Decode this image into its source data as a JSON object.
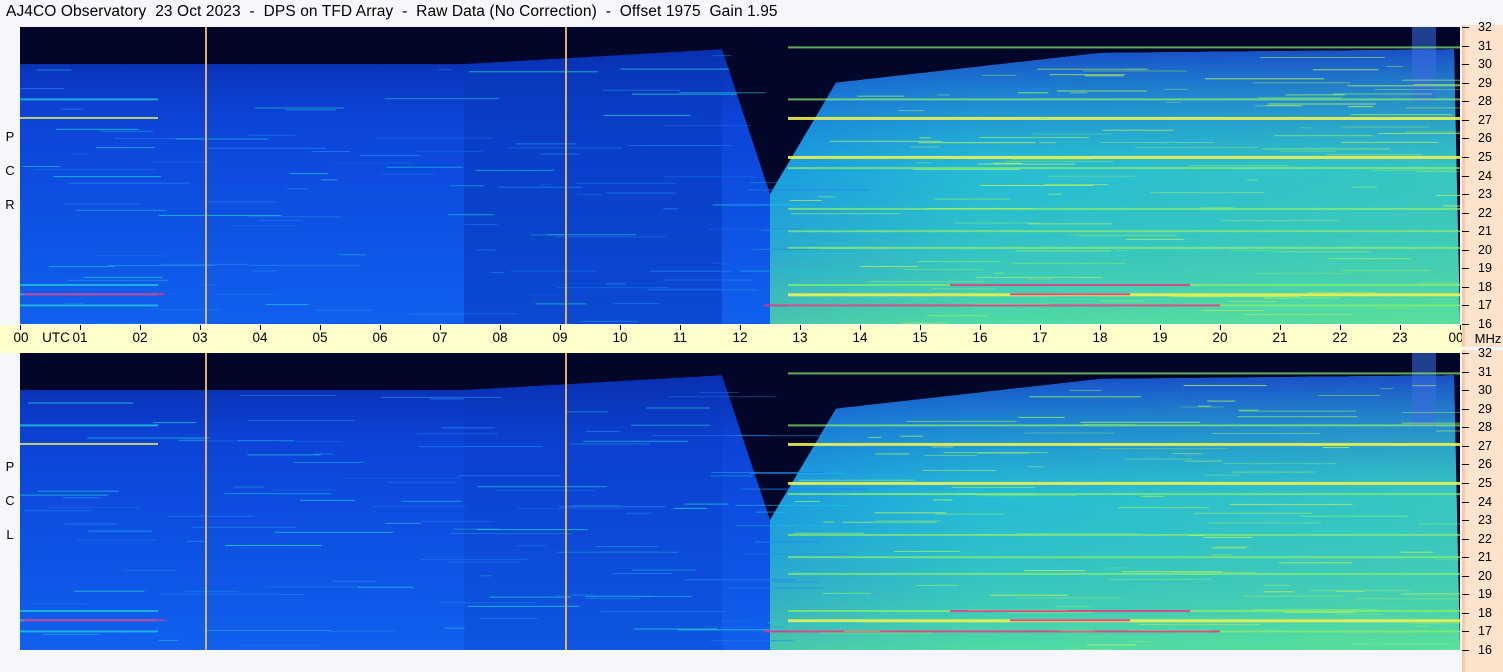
{
  "title": "AJ4CO Observatory  23 Oct 2023  -  DPS on TFD Array  -  Raw Data (No Correction)  -  Offset 1975  Gain 1.95",
  "panels": [
    {
      "id": "rcp",
      "polarization_letters": [
        "R",
        "C",
        "P"
      ]
    },
    {
      "id": "lcp",
      "polarization_letters": [
        "L",
        "C",
        "P"
      ]
    }
  ],
  "time_axis": {
    "unit_label": "UTC",
    "tick_labels": [
      "00",
      "01",
      "02",
      "03",
      "04",
      "05",
      "06",
      "07",
      "08",
      "09",
      "10",
      "11",
      "12",
      "13",
      "14",
      "15",
      "16",
      "17",
      "18",
      "19",
      "20",
      "21",
      "22",
      "23",
      "00"
    ]
  },
  "freq_axis": {
    "unit_label": "MHz",
    "tick_labels": [
      "32",
      "31",
      "30",
      "29",
      "28",
      "27",
      "26",
      "25",
      "24",
      "23",
      "22",
      "21",
      "20",
      "19",
      "18",
      "17",
      "16"
    ]
  },
  "colors": {
    "background_dark": "#02072a",
    "spectrogram_blue": "#0a47e8",
    "spectrogram_cyan": "#1ec8d8",
    "spectrogram_green": "#8ff06a",
    "spectrogram_yellow": "#f0f050",
    "spectrogram_magenta": "#e8308c",
    "marker_line": "#e0b060",
    "time_axis_bg": "#ffffcc",
    "freq_axis_bg": "#fde2cc"
  },
  "chart_data": {
    "type": "heatmap",
    "title": "AJ4CO Observatory  23 Oct 2023  -  DPS on TFD Array  -  Raw Data (No Correction)  -  Offset 1975  Gain 1.95",
    "xlabel": "UTC",
    "ylabel": "MHz",
    "xlim": [
      0,
      24
    ],
    "ylim": [
      16,
      32
    ],
    "marker_lines_utc": [
      3.1,
      9.1
    ],
    "interference_bands_mhz": [
      17.0,
      17.6,
      18.1,
      20.1,
      21.0,
      22.2,
      24.4,
      25.0,
      27.1,
      28.1,
      30.9
    ],
    "ionospheric_cutoff": [
      {
        "utc": 0,
        "mhz": 30.0
      },
      {
        "utc": 7.4,
        "mhz": 30.0
      },
      {
        "utc": 11.7,
        "mhz": 30.8
      },
      {
        "utc": 12.5,
        "mhz": 23.0
      },
      {
        "utc": 13.6,
        "mhz": 29.0
      },
      {
        "utc": 18,
        "mhz": 30.6
      },
      {
        "utc": 24,
        "mhz": 30.8
      }
    ],
    "panels": [
      "RCP",
      "LCP"
    ]
  }
}
